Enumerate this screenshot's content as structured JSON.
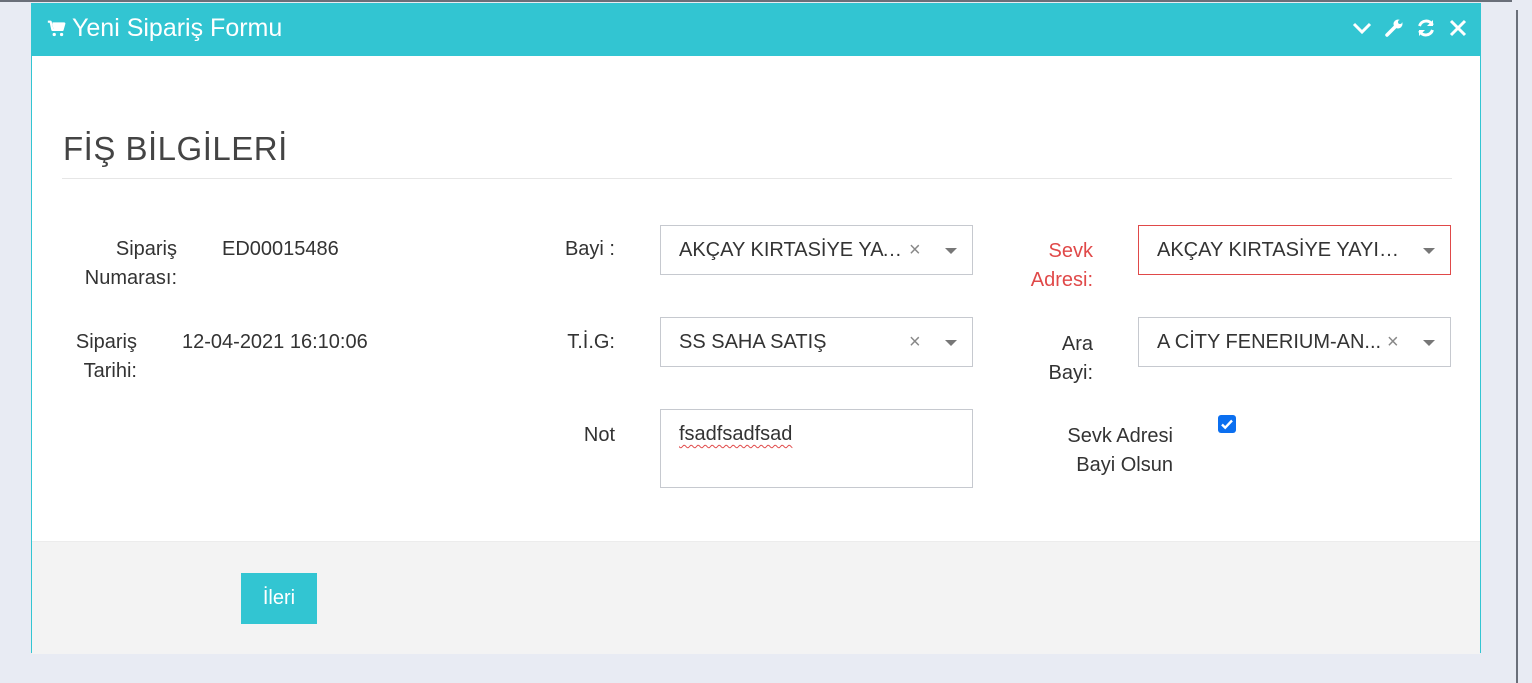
{
  "window": {
    "title": "Yeni Sipariş Formu"
  },
  "section": {
    "title": "FİŞ BİLGİLERİ"
  },
  "form": {
    "order_number_label": [
      "Sipariş",
      "Numarası:"
    ],
    "order_number_value": "ED00015486",
    "order_date_label": [
      "Sipariş",
      "Tarihi:"
    ],
    "order_date_value": "12-04-2021 16:10:06",
    "dealer_label": "Bayi :",
    "dealer_value": "AKÇAY KIRTASİYE YAY...",
    "tig_label": "T.İ.G:",
    "tig_value": "SS SAHA SATIŞ",
    "note_label": "Not",
    "note_value": "fsadfsadfsad",
    "shipping_address_label": [
      "Sevk",
      "Adresi:"
    ],
    "shipping_address_value": "AKÇAY KIRTASİYE YAYIN ...",
    "sub_dealer_label": [
      "Ara",
      "Bayi:"
    ],
    "sub_dealer_value": "A CİTY FENERIUM-AN...",
    "ship_to_dealer_label": [
      "Sevk Adresi",
      "Bayi Olsun"
    ],
    "ship_to_dealer_checked": true,
    "clear_glyph": "×"
  },
  "footer": {
    "next_button": "İleri"
  },
  "colors": {
    "accent": "#32c5d2",
    "error": "#e04949",
    "checkbox": "#0b6ff0"
  },
  "icons": [
    "cart-icon",
    "chevron-down-icon",
    "wrench-icon",
    "refresh-icon",
    "close-icon"
  ]
}
